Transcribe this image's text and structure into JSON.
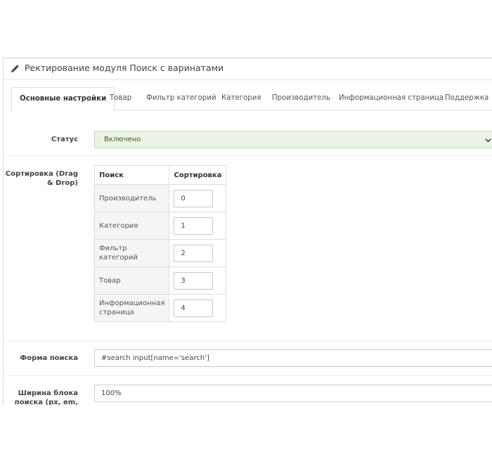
{
  "header": {
    "title": "Ректирование модуля Поиск с варинатами",
    "icon": "pencil-icon"
  },
  "tabs": [
    {
      "label": "Основные настройки",
      "active": true
    },
    {
      "label": "Товар",
      "active": false
    },
    {
      "label": "Фильтр категорий",
      "active": false
    },
    {
      "label": "Категория",
      "active": false
    },
    {
      "label": "Производитель",
      "active": false
    },
    {
      "label": "Информационная страница",
      "active": false
    },
    {
      "label": "Поддержка",
      "active": false
    }
  ],
  "status": {
    "label": "Статус",
    "value": "Включено",
    "color": "#eaf3e4"
  },
  "sorting": {
    "label": "Сортировка (Drag & Drop)",
    "columns": [
      "Поиск",
      "Сортировка"
    ],
    "rows": [
      {
        "name": "Производитель",
        "value": "0"
      },
      {
        "name": "Категория",
        "value": "1"
      },
      {
        "name": "Фильтр категорий",
        "value": "2"
      },
      {
        "name": "Товар",
        "value": "3"
      },
      {
        "name": "Информационная страница",
        "value": "4"
      }
    ]
  },
  "search_form": {
    "label": "Форма поиска",
    "value": "#search input[name='search']"
  },
  "block_width": {
    "label": "Ширина блока поиска (px, em, %)",
    "value": "100%"
  }
}
